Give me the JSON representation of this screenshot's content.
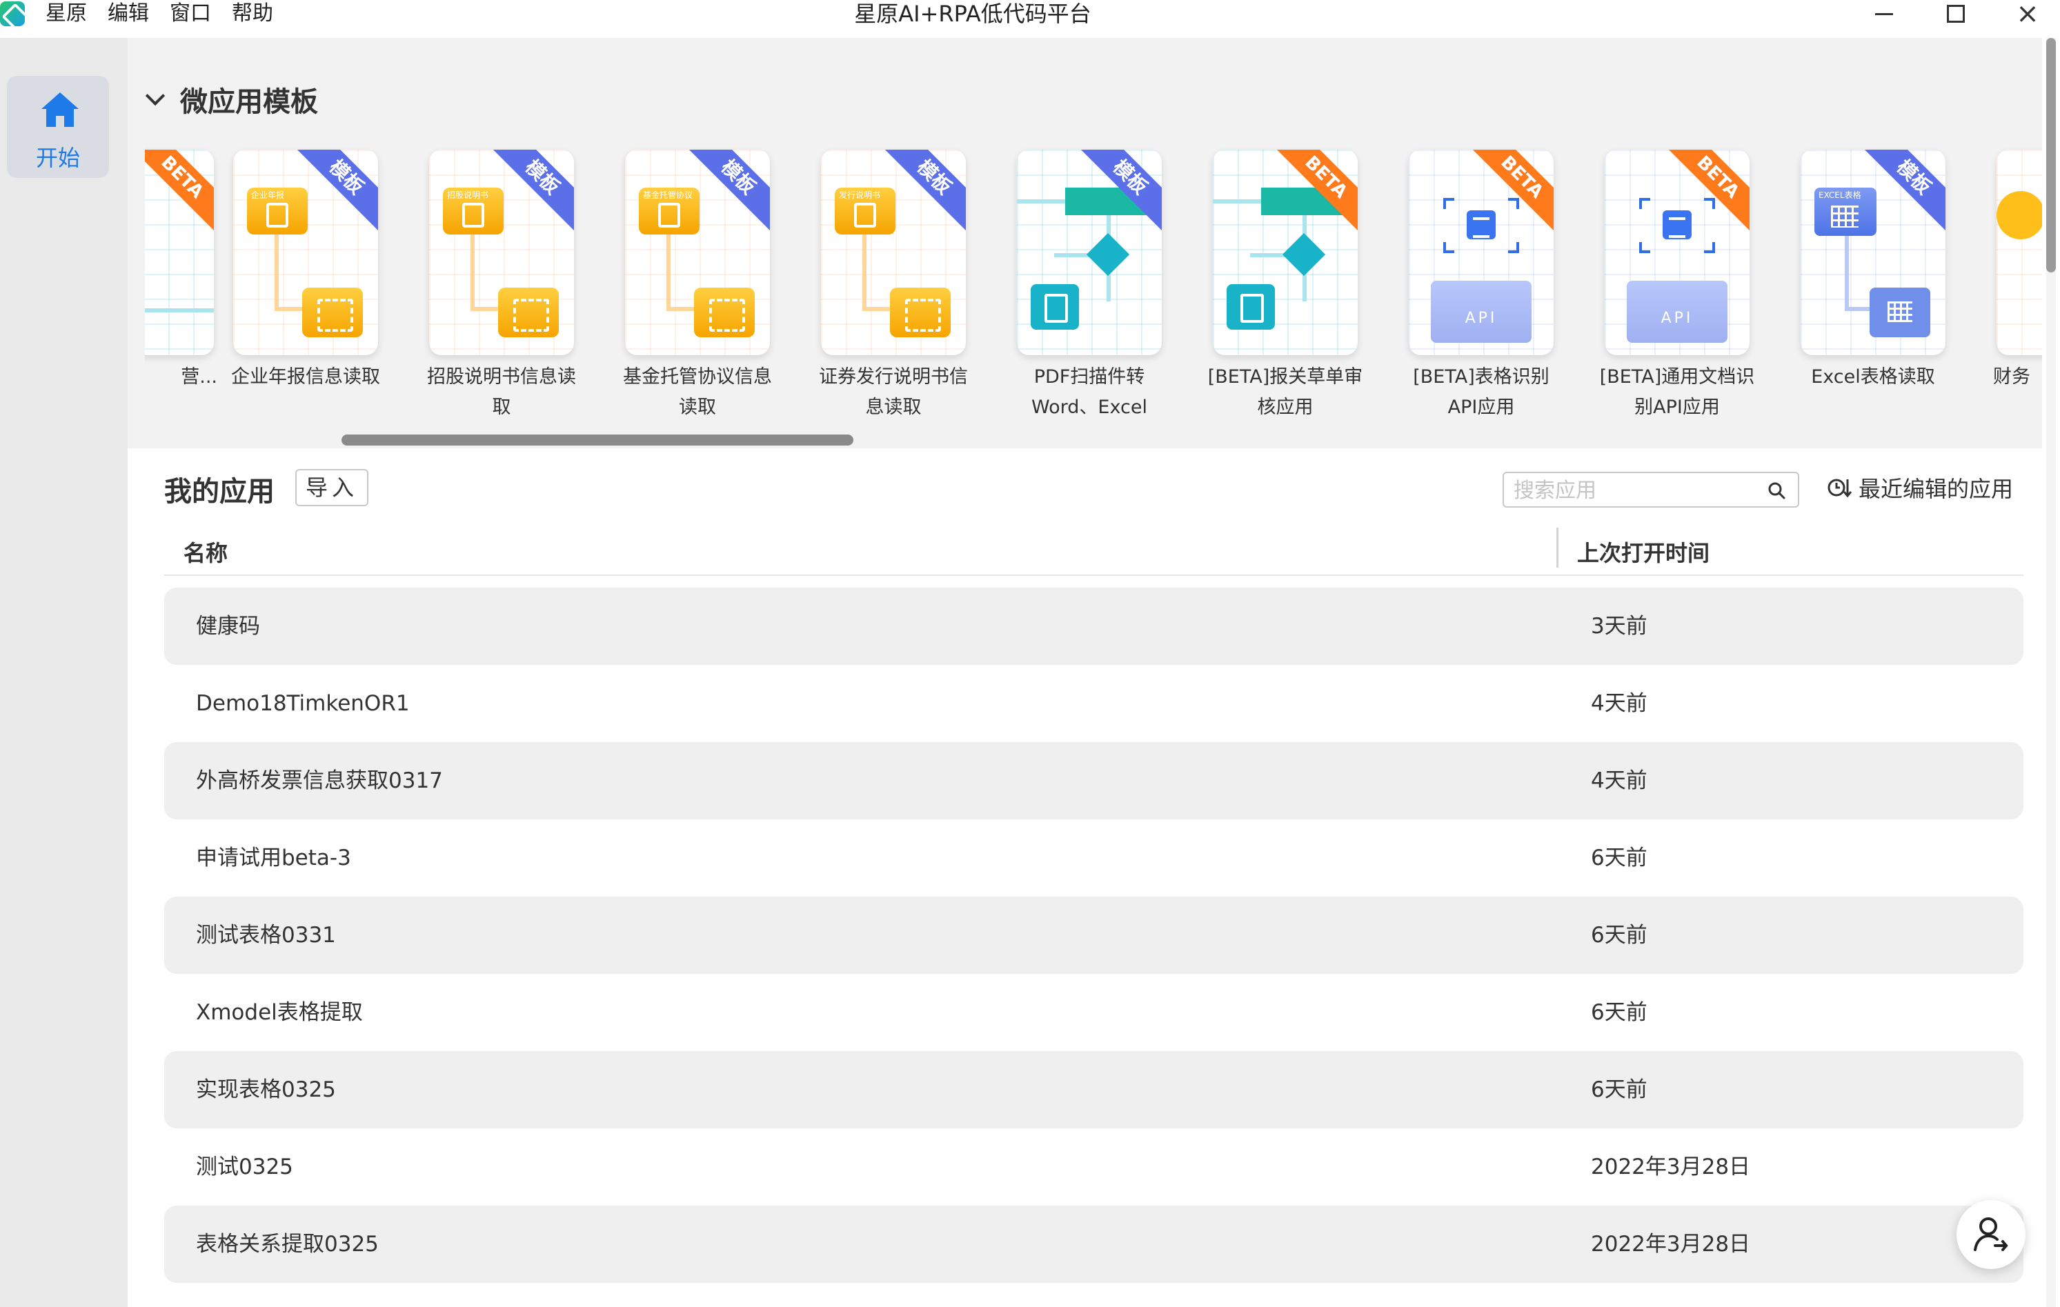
{
  "window": {
    "title": "星原AI+RPA低代码平台",
    "menu": [
      "星原",
      "编辑",
      "窗口",
      "帮助"
    ],
    "close_glyph": "×"
  },
  "sidebar": {
    "items": [
      {
        "label": "开始",
        "icon": "home-icon",
        "active": true
      }
    ]
  },
  "templates": {
    "section_title": "微应用模板",
    "cards": [
      {
        "label": "营...",
        "ribbon": "BETA",
        "style": "teal-partial"
      },
      {
        "label": "企业年报信息读取",
        "tile_label": "企业年报",
        "ribbon": "模板",
        "style": "orange"
      },
      {
        "label": "招股说明书信息读取",
        "tile_label": "招股说明书",
        "ribbon": "模板",
        "style": "orange"
      },
      {
        "label": "基金托管协议信息读取",
        "tile_label": "基金托管协议",
        "ribbon": "模板",
        "style": "orange"
      },
      {
        "label": "证券发行说明书信息读取",
        "tile_label": "发行说明书",
        "ribbon": "模板",
        "style": "orange"
      },
      {
        "label": "PDF扫描件转Word、Excel",
        "ribbon": "模板",
        "style": "teal"
      },
      {
        "label": "[BETA]报关草单审核应用",
        "ribbon": "BETA",
        "style": "teal"
      },
      {
        "label": "[BETA]表格识别API应用",
        "ribbon": "BETA",
        "style": "api"
      },
      {
        "label": "[BETA]通用文档识别API应用",
        "ribbon": "BETA",
        "style": "api"
      },
      {
        "label": "Excel表格读取",
        "tile_label": "EXCEL表格",
        "ribbon": "模板",
        "style": "excel"
      },
      {
        "label": "财务",
        "style": "partial"
      }
    ],
    "api_text": "API"
  },
  "my_apps": {
    "title": "我的应用",
    "import_label": "导入",
    "search_placeholder": "搜索应用",
    "sort_label": "最近编辑的应用",
    "columns": {
      "name": "名称",
      "last_opened": "上次打开时间"
    },
    "rows": [
      {
        "name": "健康码",
        "time": "3天前"
      },
      {
        "name": "Demo18TimkenOR1",
        "time": "4天前"
      },
      {
        "name": "外高桥发票信息获取0317",
        "time": "4天前"
      },
      {
        "name": "申请试用beta-3",
        "time": "6天前"
      },
      {
        "name": "测试表格0331",
        "time": "6天前"
      },
      {
        "name": "Xmodel表格提取",
        "time": "6天前"
      },
      {
        "name": "实现表格0325",
        "time": "6天前"
      },
      {
        "name": "测试0325",
        "time": "2022年3月28日"
      },
      {
        "name": "表格关系提取0325",
        "time": "2022年3月28日"
      }
    ]
  },
  "colors": {
    "accent_blue": "#1e7ae8",
    "ribbon_template": "#5a6fe8",
    "ribbon_beta": "#ff7a1a",
    "row_stripe": "#efefef"
  }
}
